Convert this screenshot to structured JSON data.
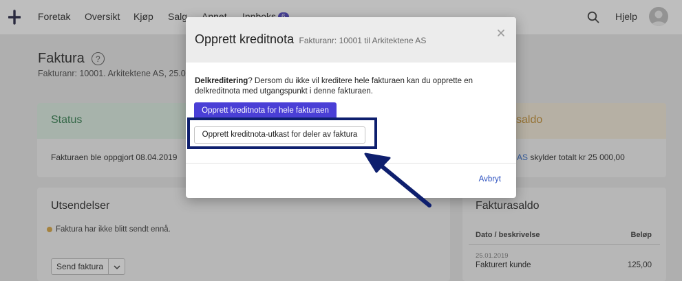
{
  "nav": {
    "items": [
      {
        "label": "Foretak"
      },
      {
        "label": "Oversikt"
      },
      {
        "label": "Kjøp"
      },
      {
        "label": "Salg"
      },
      {
        "label": "Annet"
      },
      {
        "label": "Innboks",
        "badge": "6"
      }
    ],
    "help_label": "Hjelp",
    "icons": {
      "logo": "plus-logo-icon",
      "search": "search-icon",
      "avatar": "avatar"
    }
  },
  "page": {
    "title": "Faktura",
    "subtitle": "Fakturanr: 10001. Arkitektene AS, 25.0"
  },
  "status_card": {
    "title": "Status",
    "text": "Fakturaen ble oppgjort 08.04.2019"
  },
  "saldo_card": {
    "title": "saldo",
    "link_text": "ne AS",
    "text": " skylder totalt kr 25 000,00"
  },
  "utsendelser": {
    "title": "Utsendelser",
    "message": "Faktura har ikke blitt sendt ennå.",
    "send_button": "Send faktura"
  },
  "fakturasaldo": {
    "title": "Fakturasaldo",
    "col_date": "Dato / beskrivelse",
    "col_amount": "Beløp",
    "rows": [
      {
        "date": "25.01.2019",
        "description": "Fakturert kunde",
        "amount": "125,00"
      }
    ]
  },
  "modal": {
    "title": "Opprett kreditnota",
    "subtitle": "Fakturanr: 10001 til Arkitektene AS",
    "body_bold": "Delkreditering",
    "body_text": "? Dersom du ikke vil kreditere hele fakturaen kan du opprette en delkreditnota med utgangspunkt i denne fakturaen.",
    "primary_button": "Opprett kreditnota for hele fakturaen",
    "secondary_button": "Opprett kreditnota-utkast for deler av faktura",
    "cancel_button": "Avbryt"
  },
  "colors": {
    "accent": "#4a3fd6",
    "annotation": "#0e1f6e",
    "status_green": "#2d7b4a",
    "saldo_orange": "#c08a2a"
  }
}
